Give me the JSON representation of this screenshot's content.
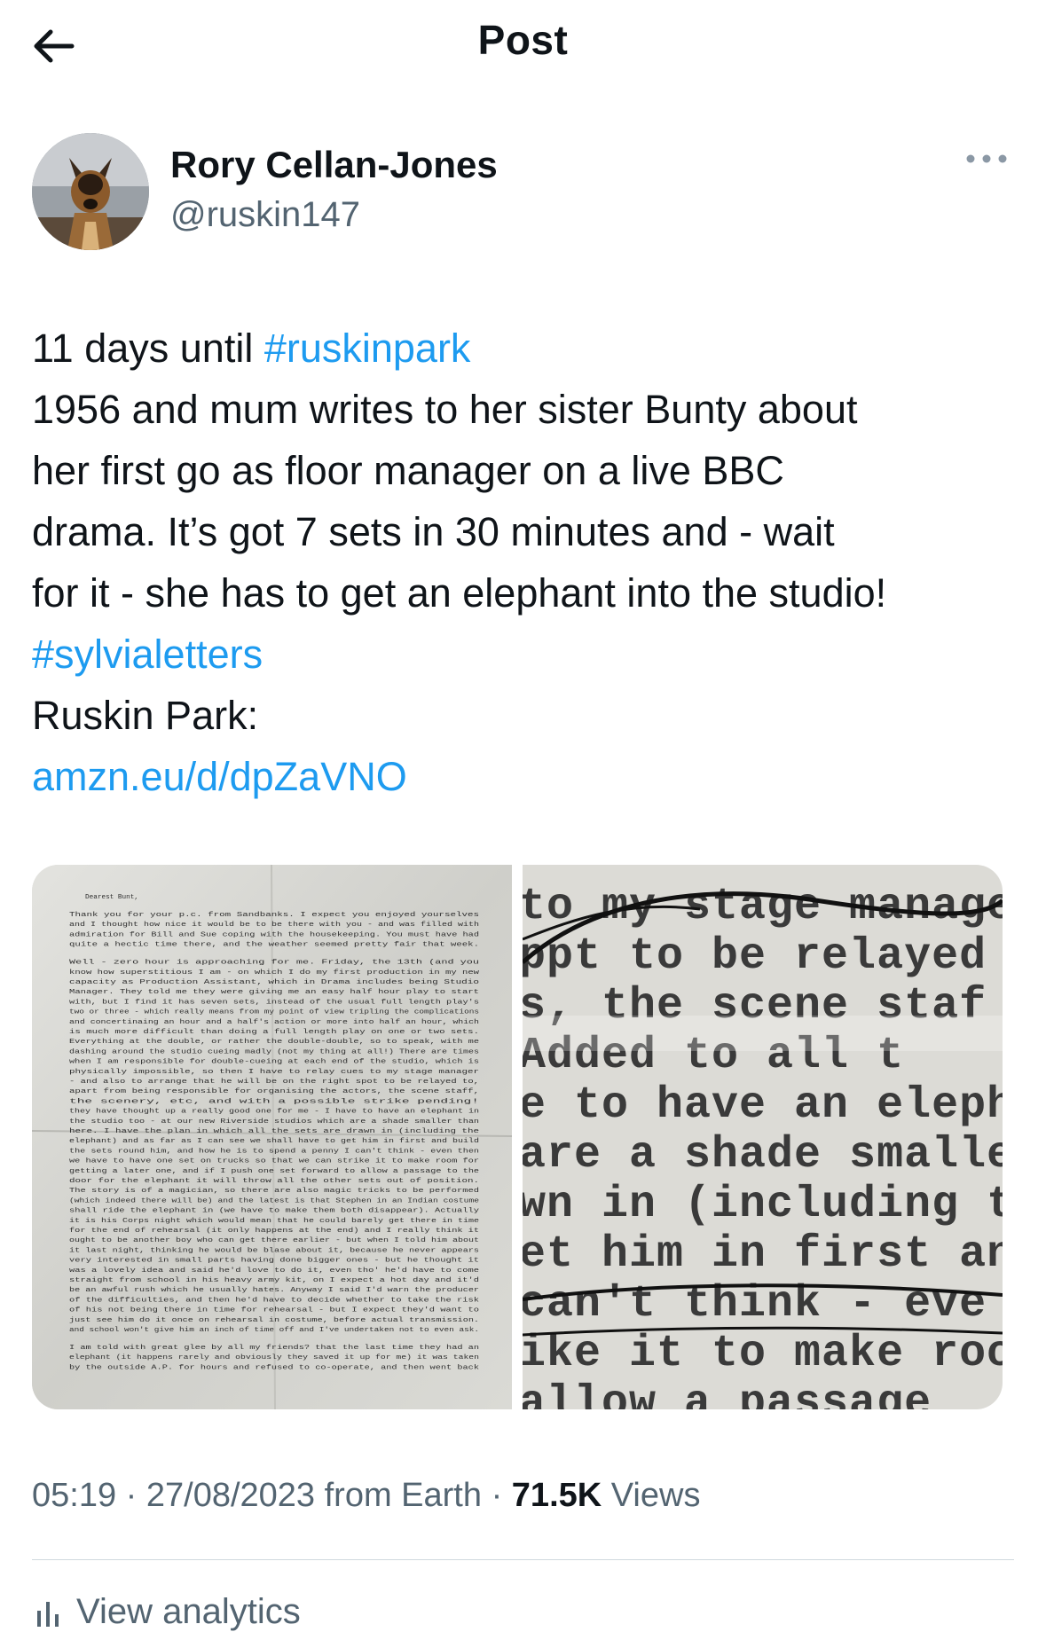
{
  "header": {
    "title": "Post"
  },
  "author": {
    "name": "Rory Cellan-Jones",
    "handle": "@ruskin147"
  },
  "tweet": {
    "line1_prefix": "11 days until ",
    "hashtag1": "#ruskinpark",
    "line2": "1956 and mum writes to her sister Bunty about",
    "line3": "her first go as floor manager on a live BBC",
    "line4": "drama. It’s got 7 sets in 30 minutes and - wait",
    "line5": "for it - she has to get an elephant into the studio!",
    "hashtag2": "#sylvialetters",
    "line7": "Ruskin Park:",
    "link": "amzn.eu/d/dpZaVNO"
  },
  "media": {
    "letter_lines": [
      "Dearest Bunt,",
      "Thank you for your p.c. from Sandbanks. I expect you enjoyed yourselves",
      "and I thought how nice it would be to be there with you - and was filled with",
      "admiration for Bill and Sue coping with the housekeeping. You must have had",
      "quite a hectic time there, and the weather seemed pretty fair that week.",
      "Well - zero hour is approaching for me. Friday, the 13th (and you",
      "know how superstitious I am - on which I do my first production in my new",
      "capacity as Production Assistant, which in Drama includes being Studio",
      "Manager. They told me they were giving me an easy half hour play to start",
      "with, but I find it has seven sets, instead of the usual full length play's",
      "two or three - which really means from my point of view tripling the complications",
      "and concertinaing an hour and a half's action or more into half an hour, which",
      "is much more difficult than doing a full length play on one or two sets.",
      "Everything at the double, or rather the double-double, so to speak, with me",
      "dashing around the studio cueing madly (not my thing at all!) There are times",
      "when I am responsible for double-cueing at each end of the studio, which is",
      "physically impossible, so then I have to relay cues to my stage manager",
      "- and also to arrange that he will be on the right spot to be relayed to,",
      "apart from being responsible for organising the actors, the scene staff,",
      "the scenery, etc, and with a possible strike pending!",
      "they have thought up a really good one for me - I have to have an elephant in",
      "the studio too - at our new Riverside studios which are a shade smaller than",
      "here. I have the plan in which all the sets are drawn in (including the",
      "elephant) and as far as I can see we shall have to get him in first and build",
      "the sets round him, and how he is to spend a penny I can't think - even then",
      "we have to have one set on trucks so that we can strike it to make room for",
      "getting a later one, and if I push one set forward to allow a passage to the",
      "door for the elephant it will throw all the other sets out of position.",
      "The story is of a magician, so there are also magic tricks to be performed",
      "(which indeed there will be) and the latest is that Stephen in an Indian costume",
      "shall ride the elephant in (we have to make them both disappear). Actually",
      "it is his Corps night which would mean that he could barely get there in time",
      "for the end of rehearsal (it only happens at the end) and I really think it",
      "ought to be another boy who can get there earlier - but when I told him about",
      "it last night, thinking he would be blase about it, because he never appears",
      "very interested in small parts having done bigger ones - but he thought it",
      "was a lovely idea and said he'd love to do it, even tho' he'd have to come",
      "straight from school in his heavy army kit, on I expect a hot day and it'd",
      "be an awful rush which he usually hates. Anyway I said I'd warn the producer",
      "of the difficulties, and then he'd have to decide whether to take the risk",
      "of his not being there in time for rehearsal - but I expect they'd want to",
      "just see him do it once on rehearsal in costume, before actual transmission.",
      "and school won't give him an inch of time off and I've undertaken not to even ask.",
      "I am told with great glee by all my friends? that the last time they had an",
      "elephant (it happens rarely and obviously they saved it up for me) it was taken",
      "by the outside A.P. for hours and refused to co-operate, and then went back"
    ],
    "zoom_lines": [
      "to my stage manage",
      "ppt to be relayed",
      "s, the scene staf",
      "  Added to all t",
      "e to have an eleph",
      "are a shade smalle",
      "wn in (including t",
      "et him in first an",
      " can't think - eve",
      "ike it to make roo",
      "  allow a passage"
    ]
  },
  "meta": {
    "time": "05:19",
    "sep1": " · ",
    "date": "27/08/2023",
    "source": " from Earth",
    "sep2": " · ",
    "views_count": "71.5K",
    "views_label": " Views"
  },
  "analytics": {
    "label": "View analytics"
  }
}
